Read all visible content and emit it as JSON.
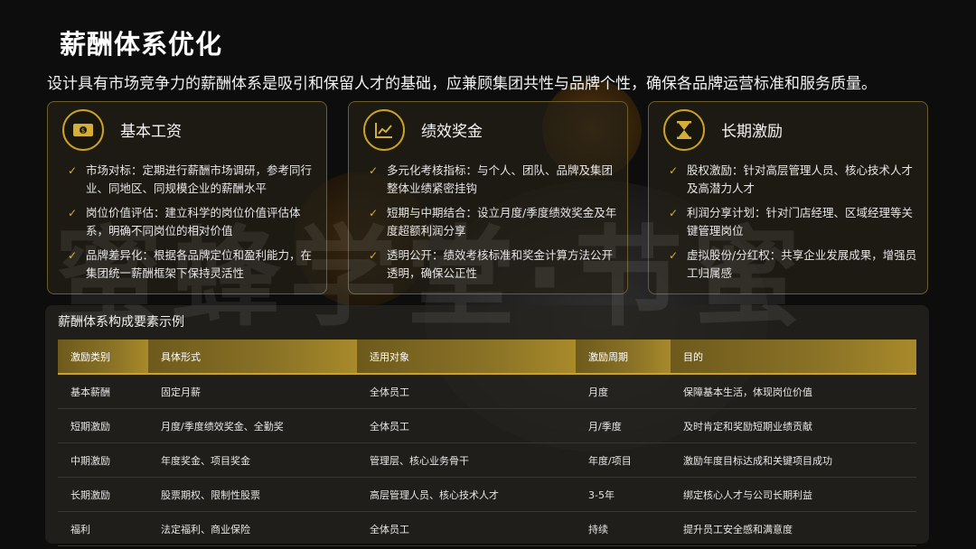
{
  "title": "薪酬体系优化",
  "subtitle": "设计具有市场竞争力的薪酬体系是吸引和保留人才的基础，应兼顾集团共性与品牌个性，确保各品牌运营标准和服务质量。",
  "watermark": "蜜蜂学堂·节蜜",
  "colors": {
    "accent": "#c9a227",
    "background": "#0d0d0d"
  },
  "cards": [
    {
      "icon": "money-icon",
      "title": "基本工资",
      "items": [
        "市场对标：定期进行薪酬市场调研，参考同行业、同地区、同规模企业的薪酬水平",
        "岗位价值评估：建立科学的岗位价值评估体系，明确不同岗位的相对价值",
        "品牌差异化：根据各品牌定位和盈利能力，在集团统一薪酬框架下保持灵活性"
      ]
    },
    {
      "icon": "line-chart-icon",
      "title": "绩效奖金",
      "items": [
        "多元化考核指标：与个人、团队、品牌及集团整体业绩紧密挂钩",
        "短期与中期结合：设立月度/季度绩效奖金及年度超额利润分享",
        "透明公开：绩效考核标准和奖金计算方法公开透明，确保公正性"
      ]
    },
    {
      "icon": "hourglass-icon",
      "title": "长期激励",
      "items": [
        "股权激励：针对高层管理人员、核心技术人才及高潜力人才",
        "利润分享计划：针对门店经理、区域经理等关键管理岗位",
        "虚拟股份/分红权：共享企业发展成果，增强员工归属感"
      ]
    }
  ],
  "table": {
    "title": "薪酬体系构成要素示例",
    "headers": [
      "激励类别",
      "具体形式",
      "适用对象",
      "激励周期",
      "目的"
    ],
    "rows": [
      [
        "基本薪酬",
        "固定月薪",
        "全体员工",
        "月度",
        "保障基本生活，体现岗位价值"
      ],
      [
        "短期激励",
        "月度/季度绩效奖金、全勤奖",
        "全体员工",
        "月/季度",
        "及时肯定和奖励短期业绩贡献"
      ],
      [
        "中期激励",
        "年度奖金、项目奖金",
        "管理层、核心业务骨干",
        "年度/项目",
        "激励年度目标达成和关键项目成功"
      ],
      [
        "长期激励",
        "股票期权、限制性股票",
        "高层管理人员、核心技术人才",
        "3-5年",
        "绑定核心人才与公司长期利益"
      ],
      [
        "福利",
        "法定福利、商业保险",
        "全体员工",
        "持续",
        "提升员工安全感和满意度"
      ]
    ]
  }
}
